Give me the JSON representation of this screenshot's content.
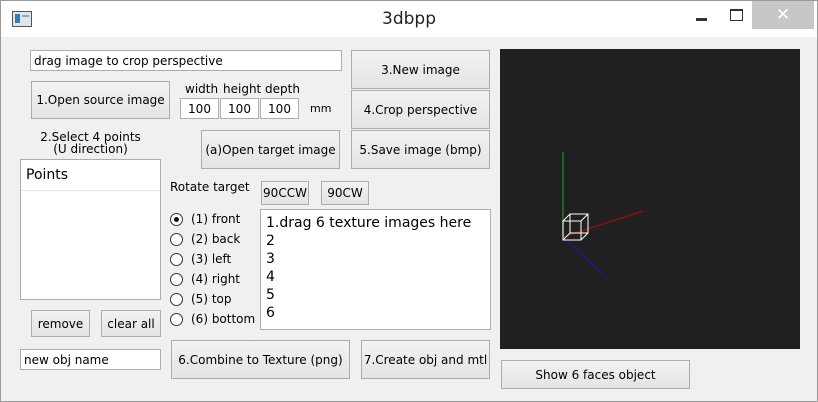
{
  "window": {
    "title": "3dbpp"
  },
  "toolbar": {
    "hint_value": "drag image to crop perspective",
    "open_source_label": "1.Open source image",
    "new_image_label": "3.New image",
    "crop_perspective_label": "4.Crop perspective",
    "save_image_label": "5.Save image (bmp)",
    "open_target_label": "(a)Open target image"
  },
  "dimensions": {
    "width_label": "width",
    "height_label": "height",
    "depth_label": "depth",
    "width_value": "100",
    "height_value": "100",
    "depth_value": "100",
    "unit": "mm"
  },
  "points": {
    "instruction_line1": "2.Select 4 points",
    "instruction_line2": "(U direction)",
    "column_header": "Points",
    "remove_label": "remove",
    "clear_all_label": "clear all"
  },
  "rotate": {
    "label": "Rotate target",
    "ccw_label": "90CCW",
    "cw_label": "90CW"
  },
  "faces": [
    {
      "label": "(1) front",
      "checked": true
    },
    {
      "label": "(2) back",
      "checked": false
    },
    {
      "label": "(3) left",
      "checked": false
    },
    {
      "label": "(4) right",
      "checked": false
    },
    {
      "label": "(5) top",
      "checked": false
    },
    {
      "label": "(6) bottom",
      "checked": false
    }
  ],
  "texture_list": [
    "1.drag 6 texture images here",
    "2",
    "3",
    "4",
    "5",
    "6"
  ],
  "bottom": {
    "obj_name_value": "new obj name",
    "combine_label": "6.Combine to Texture (png)",
    "create_obj_label": "7.Create obj and mtl",
    "show_faces_label": "Show 6 faces object"
  },
  "viewport": {
    "background": "#202020",
    "y_axis_color": "#1f7a1f",
    "x_axis_color": "#8a1010",
    "z_axis_color": "#1a1a8a",
    "cube_color": "#ffffff"
  }
}
